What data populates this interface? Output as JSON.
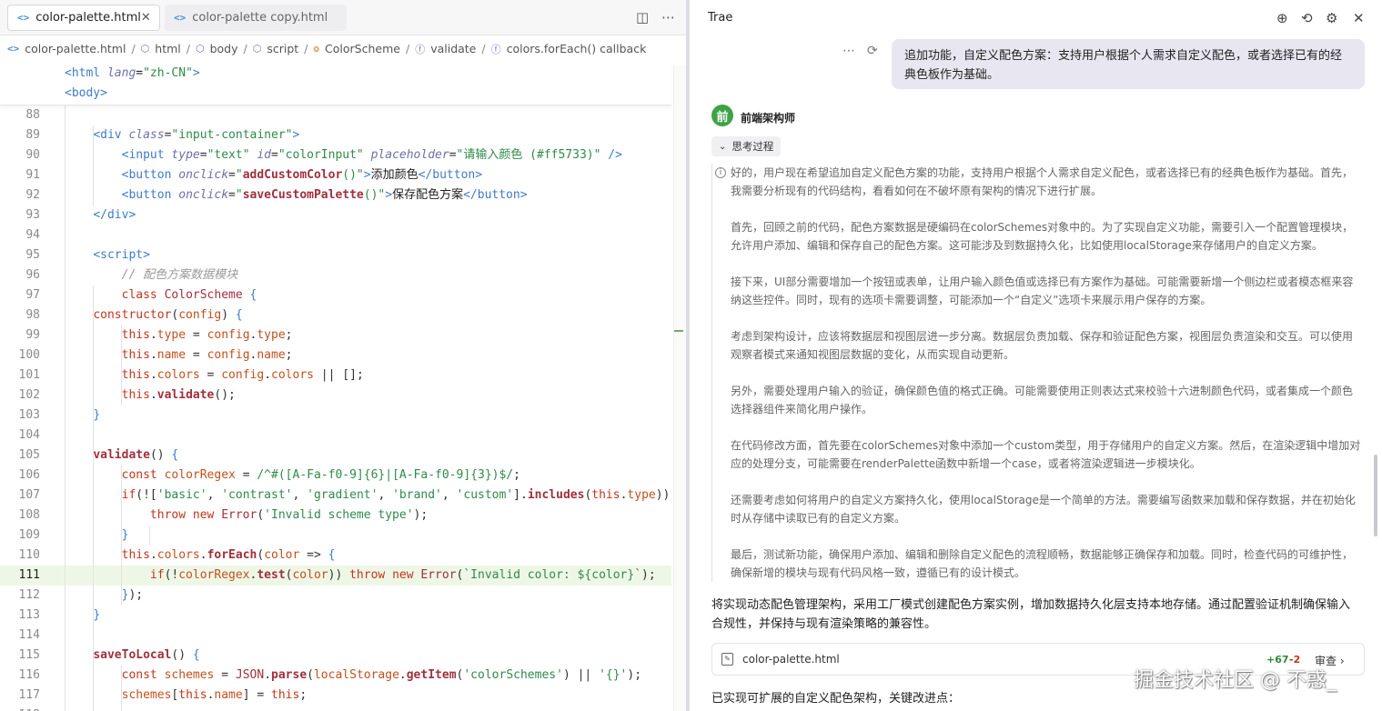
{
  "editor": {
    "tabs": [
      {
        "label": "color-palette.html",
        "close": "✕"
      },
      {
        "label": "color-palette copy.html"
      }
    ],
    "tab_icon": "<>",
    "toolbar": {
      "split_icon": "◫",
      "more_icon": "⋯"
    },
    "breadcrumb": [
      "color-palette.html",
      "html",
      "body",
      "script",
      "ColorScheme",
      "validate",
      "colors.forEach() callback"
    ],
    "breadcrumb_sep": "/",
    "sticky": [
      "<html lang=\"zh-CN\">",
      "<body>"
    ]
  },
  "chat": {
    "title": "Trae",
    "user_message": "追加功能，自定义配色方案：支持用户根据个人需求自定义配色，或者选择已有的经典色板作为基础。",
    "agent_avatar": "前",
    "agent_name": "前端架构师",
    "think_label": "思考过程",
    "thinking": [
      "好的，用户现在希望追加自定义配色方案的功能，支持用户根据个人需求自定义配色，或者选择已有的经典色板作为基础。首先，我需要分析现有的代码结构，看看如何在不破坏原有架构的情况下进行扩展。",
      "首先，回顾之前的代码，配色方案数据是硬编码在colorSchemes对象中的。为了实现自定义功能，需要引入一个配置管理模块，允许用户添加、编辑和保存自己的配色方案。这可能涉及到数据持久化，比如使用localStorage来存储用户的自定义方案。",
      "接下来，UI部分需要增加一个按钮或表单，让用户输入颜色值或选择已有方案作为基础。可能需要新增一个侧边栏或者模态框来容纳这些控件。同时，现有的选项卡需要调整，可能添加一个“自定义”选项卡来展示用户保存的方案。",
      "考虑到架构设计，应该将数据层和视图层进一步分离。数据层负责加载、保存和验证配色方案，视图层负责渲染和交互。可以使用观察者模式来通知视图层数据的变化，从而实现自动更新。",
      "另外，需要处理用户输入的验证，确保颜色值的格式正确。可能需要使用正则表达式来校验十六进制颜色代码，或者集成一个颜色选择器组件来简化用户操作。",
      "在代码修改方面，首先要在colorSchemes对象中添加一个custom类型，用于存储用户的自定义方案。然后，在渲染逻辑中增加对应的处理分支，可能需要在renderPalette函数中新增一个case，或者将渲染逻辑进一步模块化。",
      "还需要考虑如何将用户的自定义方案持久化，使用localStorage是一个简单的方法。需要编写函数来加载和保存数据，并在初始化时从存储中读取已有的自定义方案。",
      "最后，测试新功能，确保用户添加、编辑和删除自定义配色的流程顺畅，数据能够正确保存和加载。同时，检查代码的可维护性，确保新增的模块与现有代码风格一致，遵循已有的设计模式。"
    ],
    "summary": "将实现动态配色管理架构，采用工厂模式创建配色方案实例，增加数据持久化层支持本地存储。通过配置验证机制确保输入合规性，并保持与现有渲染策略的兼容性。",
    "file_card": {
      "name": "color-palette.html",
      "added": "+67",
      "removed": "-2",
      "review": "审查 ›"
    },
    "last_line": "已实现可扩展的自定义配色架构，关键改进点：",
    "watermark": "掘金技术社区 @ 不惑_"
  }
}
